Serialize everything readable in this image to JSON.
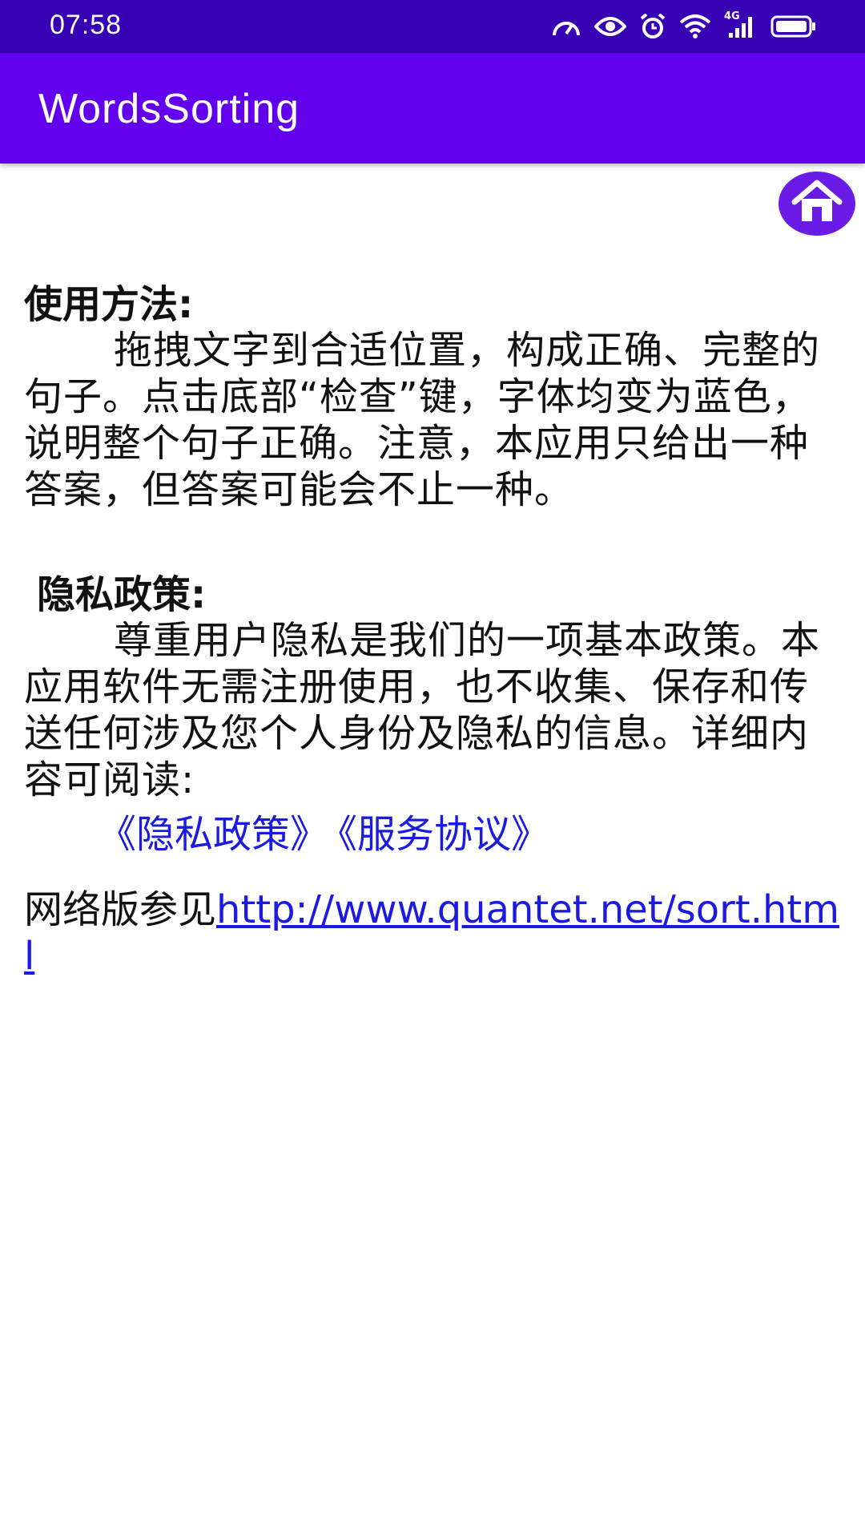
{
  "status_bar": {
    "time": "07:58",
    "icons": [
      "speedometer-icon",
      "eye-icon",
      "alarm-icon",
      "wifi-icon",
      "signal-4g-icon",
      "battery-icon"
    ],
    "network_label": "4G"
  },
  "app_bar": {
    "title": "WordsSorting",
    "color": "#6200ee",
    "status_color": "#3700b3"
  },
  "home_button": {
    "icon": "home-icon"
  },
  "usage": {
    "title": "使用方法:",
    "body": "拖拽文字到合适位置，构成正确、完整的句子。点击底部“检查”键，字体均变为蓝色，说明整个句子正确。注意，本应用只给出一种答案，但答案可能会不止一种。"
  },
  "privacy": {
    "title": "隐私政策:",
    "body": "尊重用户隐私是我们的一项基本政策。本应用软件无需注册使用，也不收集、保存和传送任何涉及您个人身份及隐私的信息。详细内容可阅读:",
    "policy_link": "《隐私政策》",
    "service_link": "《服务协议》"
  },
  "web": {
    "prefix": "网络版参见",
    "url": "http://www.quantet.net/sort.html"
  },
  "link_color": "#1a1ae0"
}
